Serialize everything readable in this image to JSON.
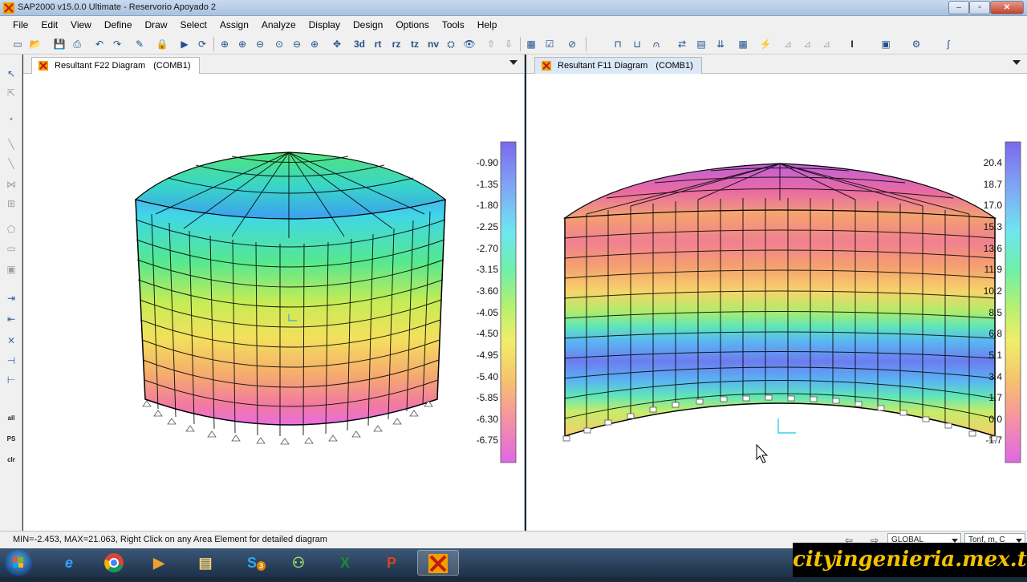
{
  "window": {
    "title": "SAP2000 v15.0.0 Ultimate  -  Reservorio Apoyado 2",
    "controls": [
      "minimize",
      "maximize",
      "close"
    ]
  },
  "menu": [
    "File",
    "Edit",
    "View",
    "Define",
    "Draw",
    "Select",
    "Assign",
    "Analyze",
    "Display",
    "Design",
    "Options",
    "Tools",
    "Help"
  ],
  "toolbar": {
    "text_buttons": [
      "rt",
      "rz",
      "tz",
      "nv"
    ],
    "icons": [
      "new-icon",
      "open-icon",
      "save-icon",
      "print-icon",
      "undo-icon",
      "redo-icon",
      "pencil-icon",
      "lock-icon",
      "run-icon",
      "rotate-3d-icon",
      "zoom-window-icon",
      "zoom-in-icon",
      "zoom-out-icon",
      "zoom-extents-icon",
      "zoom-previous-icon",
      "zoom-step-icon",
      "pan-icon",
      "3d-view-icon",
      "xy-view-icon",
      "perspective-icon",
      "eye-icon",
      "up-arrow-icon",
      "down-arrow-icon"
    ]
  },
  "panes": [
    {
      "tab_title": "Resultant F22 Diagram",
      "combo": "(COMB1)",
      "scale": [
        "-0.90",
        "-1.35",
        "-1.80",
        "-2.25",
        "-2.70",
        "-3.15",
        "-3.60",
        "-4.05",
        "-4.50",
        "-4.95",
        "-5.40",
        "-5.85",
        "-6.30",
        "-6.75"
      ]
    },
    {
      "tab_title": "Resultant F11 Diagram",
      "combo": "(COMB1)",
      "scale": [
        "20.4",
        "18.7",
        "17.0",
        "15.3",
        "13.6",
        "11.9",
        "10.2",
        "8.5",
        "6.8",
        "5.1",
        "3.4",
        "1.7",
        "0.0",
        "-1.7"
      ]
    }
  ],
  "colors": {
    "scale_top": "#7b68ee",
    "scale_bottom": "#e066e6",
    "window_bg": "#f0f0f0",
    "watermark_text": "#f2c200"
  },
  "status": {
    "message": "MIN=-2.453, MAX=21.063, Right Click on any Area Element for detailed diagram",
    "coord_system": "GLOBAL",
    "units": "Tonf, m, C"
  },
  "taskbar": {
    "apps": [
      "internet-explorer-icon",
      "chrome-icon",
      "media-player-icon",
      "file-explorer-icon",
      "skype-icon",
      "network-icon",
      "excel-icon",
      "powerpoint-icon",
      "sap2000-icon"
    ],
    "skype_badge": "3"
  },
  "watermark": "cityingenieria.mex.tl"
}
